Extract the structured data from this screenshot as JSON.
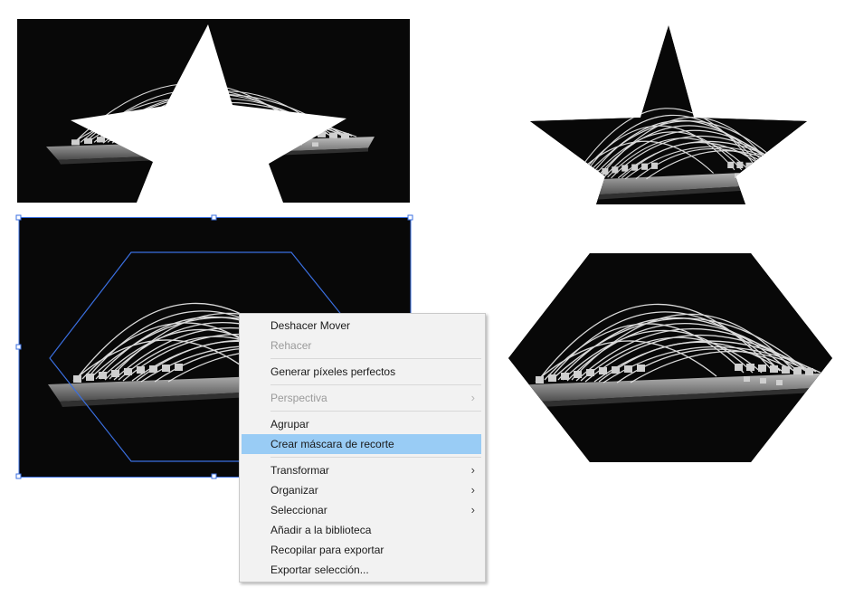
{
  "context_menu": {
    "items": [
      {
        "label": "Deshacer Mover",
        "disabled": false,
        "submenu": false
      },
      {
        "label": "Rehacer",
        "disabled": true,
        "submenu": false
      },
      {
        "label": "Generar píxeles perfectos",
        "disabled": false,
        "submenu": false
      },
      {
        "label": "Perspectiva",
        "disabled": true,
        "submenu": true
      },
      {
        "label": "Agrupar",
        "disabled": false,
        "submenu": false
      },
      {
        "label": "Crear máscara de recorte",
        "disabled": false,
        "submenu": false,
        "highlighted": true
      },
      {
        "label": "Transformar",
        "disabled": false,
        "submenu": true
      },
      {
        "label": "Organizar",
        "disabled": false,
        "submenu": true
      },
      {
        "label": "Seleccionar",
        "disabled": false,
        "submenu": true
      },
      {
        "label": "Añadir a la biblioteca",
        "disabled": false,
        "submenu": false
      },
      {
        "label": "Recopilar para exportar",
        "disabled": false,
        "submenu": false
      },
      {
        "label": "Exportar selección...",
        "disabled": false,
        "submenu": false
      }
    ]
  },
  "icons": {
    "submenu_arrow": "chevron-right-icon"
  },
  "colors": {
    "selection_blue": "#3a6fe0",
    "menu_highlight": "#99ccf5",
    "artwork_background": "#080808"
  }
}
